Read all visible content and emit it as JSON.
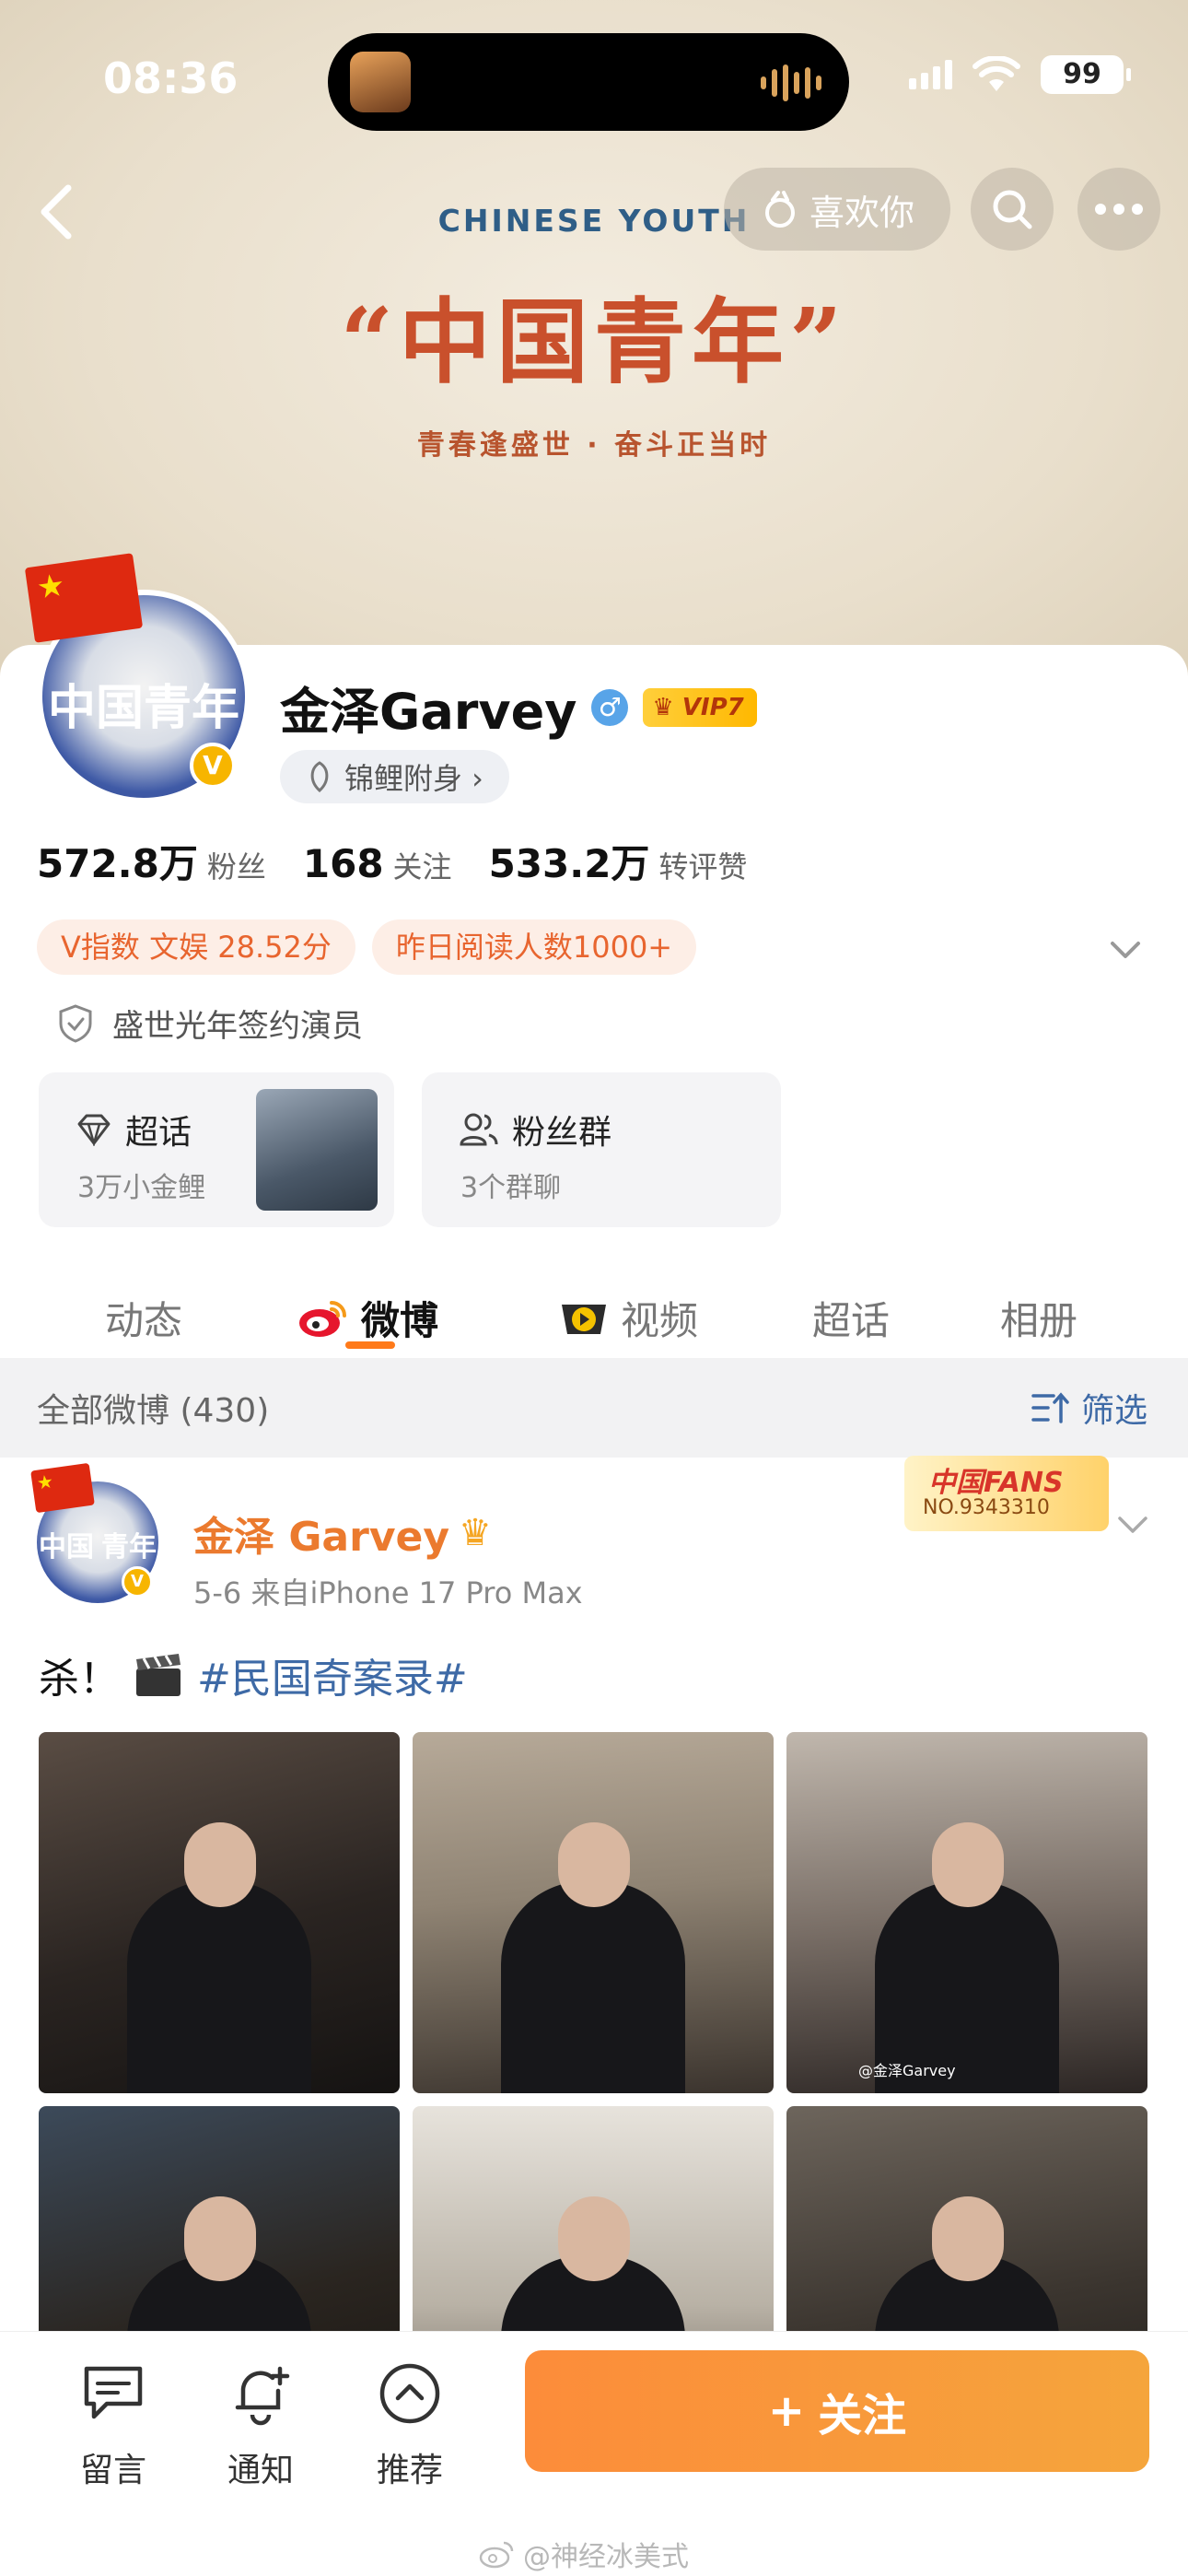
{
  "status": {
    "time": "08:36",
    "battery": "99"
  },
  "banner": {
    "sub": "CHINESE YOUTH",
    "title": "“中国青年”",
    "slogan": "青春逢盛世 · 奋斗正当时"
  },
  "nav": {
    "like_label": "喜欢你"
  },
  "profile": {
    "avatar_text_left": "中国",
    "avatar_text_right": "青年",
    "name": "金泽Garvey",
    "vip_label": "VIP7",
    "koi_label": "锦鲤附身 ›",
    "stats": [
      {
        "num": "572.8万",
        "label": "粉丝"
      },
      {
        "num": "168",
        "label": "关注"
      },
      {
        "num": "533.2万",
        "label": "转评赞"
      }
    ],
    "tags": [
      "V指数 文娱 28.52分",
      "昨日阅读人数1000+"
    ],
    "verified": "盛世光年签约演员",
    "supertopic": {
      "title": "超话",
      "sub": "3万小金鲤"
    },
    "fan_group": {
      "title": "粉丝群",
      "sub": "3个群聊"
    }
  },
  "tabs": [
    "动态",
    "微博",
    "视频",
    "超话",
    "相册"
  ],
  "filter": {
    "left": "全部微博 (430)",
    "right": "筛选"
  },
  "post": {
    "avatar_text_left": "中国",
    "avatar_text_right": "青年",
    "name": "金泽 Garvey",
    "meta": "5-6  来自iPhone 17 Pro Max",
    "fans_top": "中国FANS",
    "fans_no": "NO.9343310",
    "text_prefix": "杀！",
    "hashtag": "#民国奇案录#",
    "photo_watermark": "@金泽Garvey"
  },
  "bottom": {
    "message": "留言",
    "notify": "通知",
    "recommend": "推荐",
    "follow": "关注",
    "plus": "+"
  },
  "watermark": "@神经冰美式"
}
